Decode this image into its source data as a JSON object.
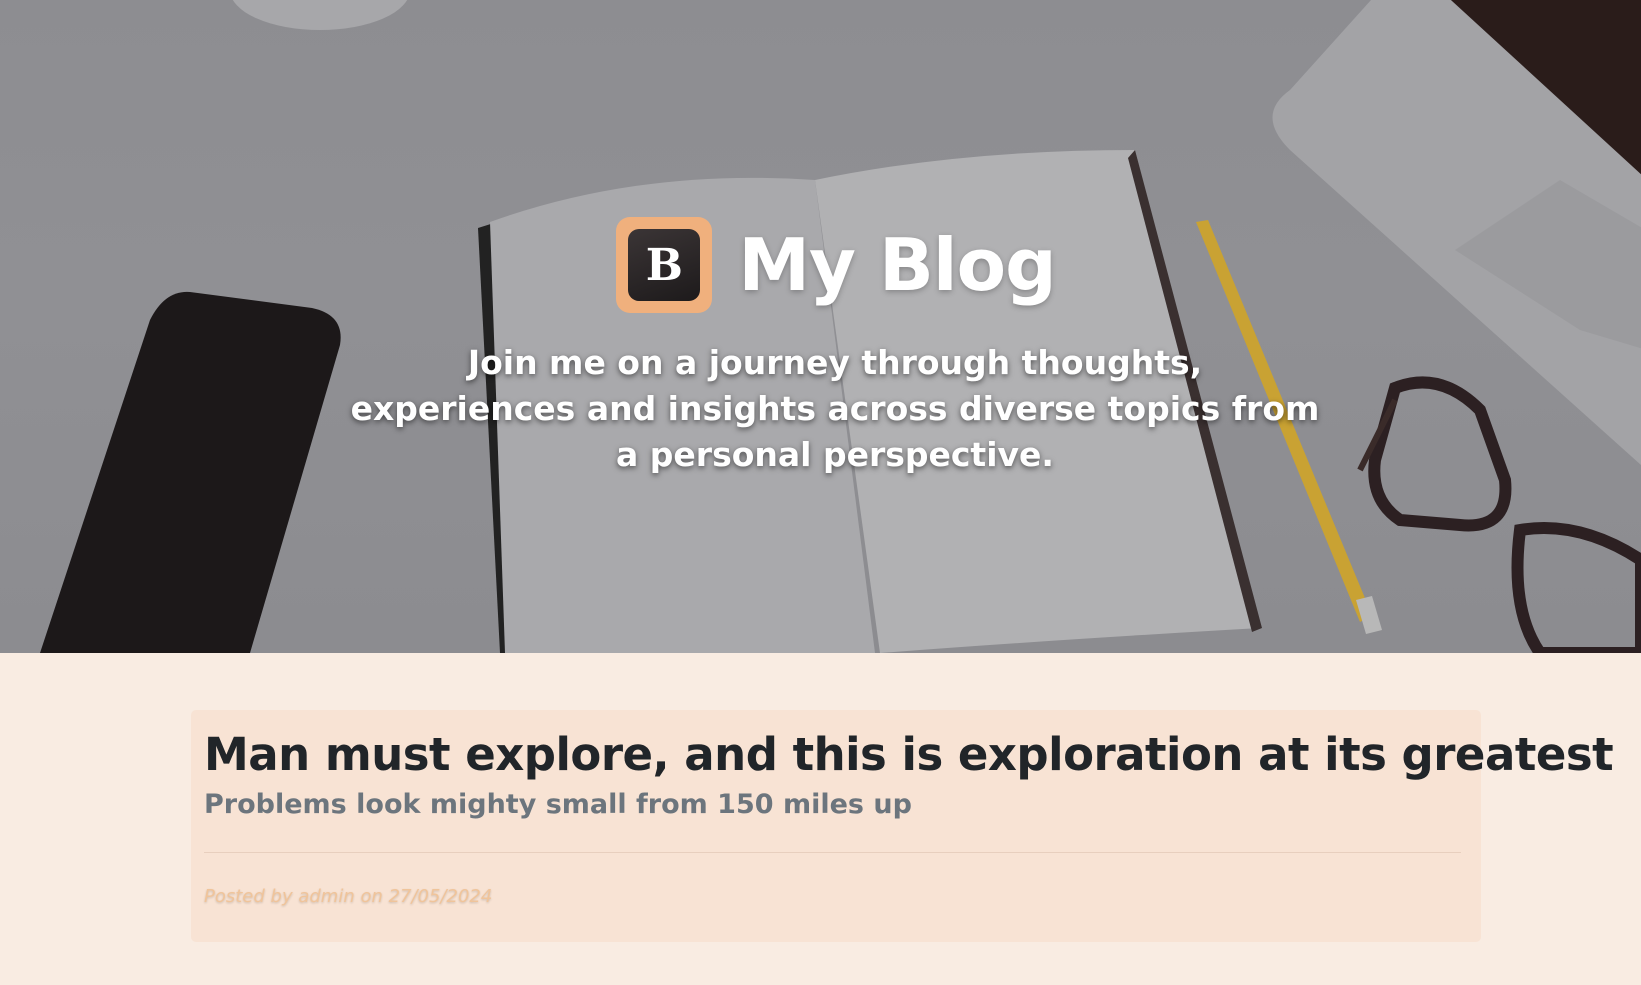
{
  "header": {
    "logo_letter": "B",
    "title": "My Blog",
    "tagline": "Join me on a journey through thoughts, experiences and insights across diverse topics from a personal perspective."
  },
  "post": {
    "title": "Man must explore, and this is exploration at its greatest",
    "subtitle": "Problems look mighty small from 150 miles up",
    "meta": "Posted by admin on 27/05/2024"
  },
  "colors": {
    "page_background": "#f9ece2",
    "card_background": "#f8e3d4",
    "logo_accent": "#f0b07d",
    "meta_text": "#f0c49a"
  }
}
